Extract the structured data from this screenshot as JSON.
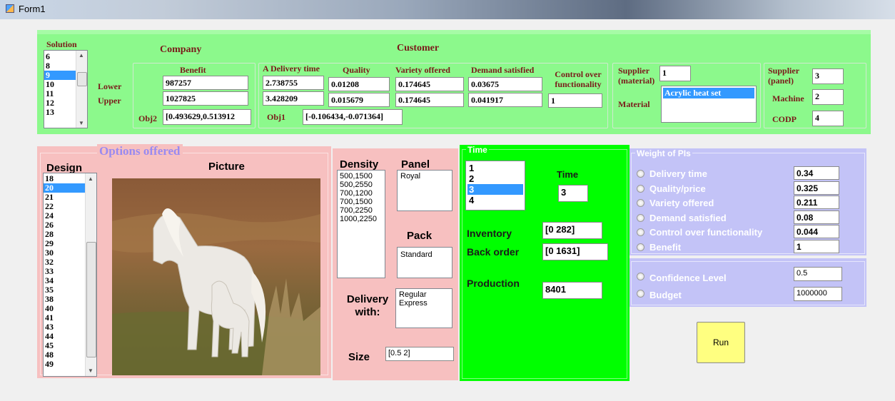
{
  "window": {
    "title": "Form1"
  },
  "top": {
    "solution_label": "Solution",
    "solution_items": [
      "6",
      "8",
      "9",
      "10",
      "11",
      "12",
      "13"
    ],
    "solution_selected": "9",
    "company_label": "Company",
    "customer_label": "Customer",
    "lower_label": "Lower",
    "upper_label": "Upper",
    "benefit_label": "Benefit",
    "benefit_lower": "987257",
    "benefit_upper": "1027825",
    "obj2_label": "Obj2",
    "obj2_value": "[0.493629,0.513912",
    "delivery_label": "A Delivery time",
    "delivery_lower": "2.738755",
    "delivery_upper": "3.428209",
    "quality_label": "Quality",
    "quality_lower": "0.01208",
    "quality_upper": "0.015679",
    "variety_label": "Variety offered",
    "variety_lower": "0.174645",
    "variety_upper": "0.174645",
    "demand_label": "Demand satisfied",
    "demand_lower": "0.03675",
    "demand_upper": "0.041917",
    "control_label": "Control over functionality",
    "control_value": "1",
    "obj1_label": "Obj1",
    "obj1_value": "[-0.106434,-0.071364]",
    "supplier_material_label": "Supplier (material)",
    "supplier_material_value": "1",
    "material_label": "Material",
    "material_items": [
      "Acrylic heat set"
    ],
    "supplier_panel_label": "Supplier (panel)",
    "supplier_panel_value": "3",
    "machine_label": "Machine",
    "machine_value": "2",
    "codp_label": "CODP",
    "codp_value": "4"
  },
  "options": {
    "title": "Options offered",
    "design_label": "Design",
    "design_items": [
      "18",
      "20",
      "21",
      "22",
      "24",
      "26",
      "28",
      "29",
      "30",
      "32",
      "33",
      "34",
      "35",
      "38",
      "40",
      "41",
      "43",
      "44",
      "45",
      "48",
      "49"
    ],
    "design_selected": "20",
    "picture_label": "Picture",
    "density_label": "Density",
    "density_items": [
      "500,1500",
      "500,2550",
      "700,1200",
      "700,1500",
      "700,2250",
      "1000,2250"
    ],
    "panel_label": "Panel",
    "panel_items": [
      "Royal"
    ],
    "pack_label": "Pack",
    "pack_items": [
      "Standard"
    ],
    "delivery_with_label": "Delivery with:",
    "delivery_items": [
      "Regular",
      "Express"
    ],
    "size_label": "Size",
    "size_value": "[0.5  2]"
  },
  "time": {
    "group_label": "Time",
    "items": [
      "1",
      "2",
      "3",
      "4"
    ],
    "selected": "3",
    "time_label": "Time",
    "time_value": "3",
    "inventory_label": "Inventory",
    "inventory_value": "[0  282]",
    "backorder_label": "Back order",
    "backorder_value": "[0  1631]",
    "production_label": "Production",
    "production_value": "8401"
  },
  "weights": {
    "group_label": "Weight of PIs",
    "delivery_label": "Delivery time",
    "delivery_value": "0.34",
    "quality_label": "Quality/price",
    "quality_value": "0.325",
    "variety_label": "Variety offered",
    "variety_value": "0.211",
    "demand_label": "Demand satisfied",
    "demand_value": "0.08",
    "control_label": "Control over functionality",
    "control_value": "0.044",
    "benefit_label": "Benefit",
    "benefit_value": "1",
    "confidence_label": "Confidence Level",
    "confidence_value": "0.5",
    "budget_label": "Budget",
    "budget_value": "1000000"
  },
  "run_label": "Run",
  "colors": {
    "green_panel": "#8cf98c",
    "pink_panel": "#f7c0c0",
    "time_panel": "#00ff00",
    "weights_panel": "#c3c3f7",
    "run_button": "#ffff80"
  }
}
